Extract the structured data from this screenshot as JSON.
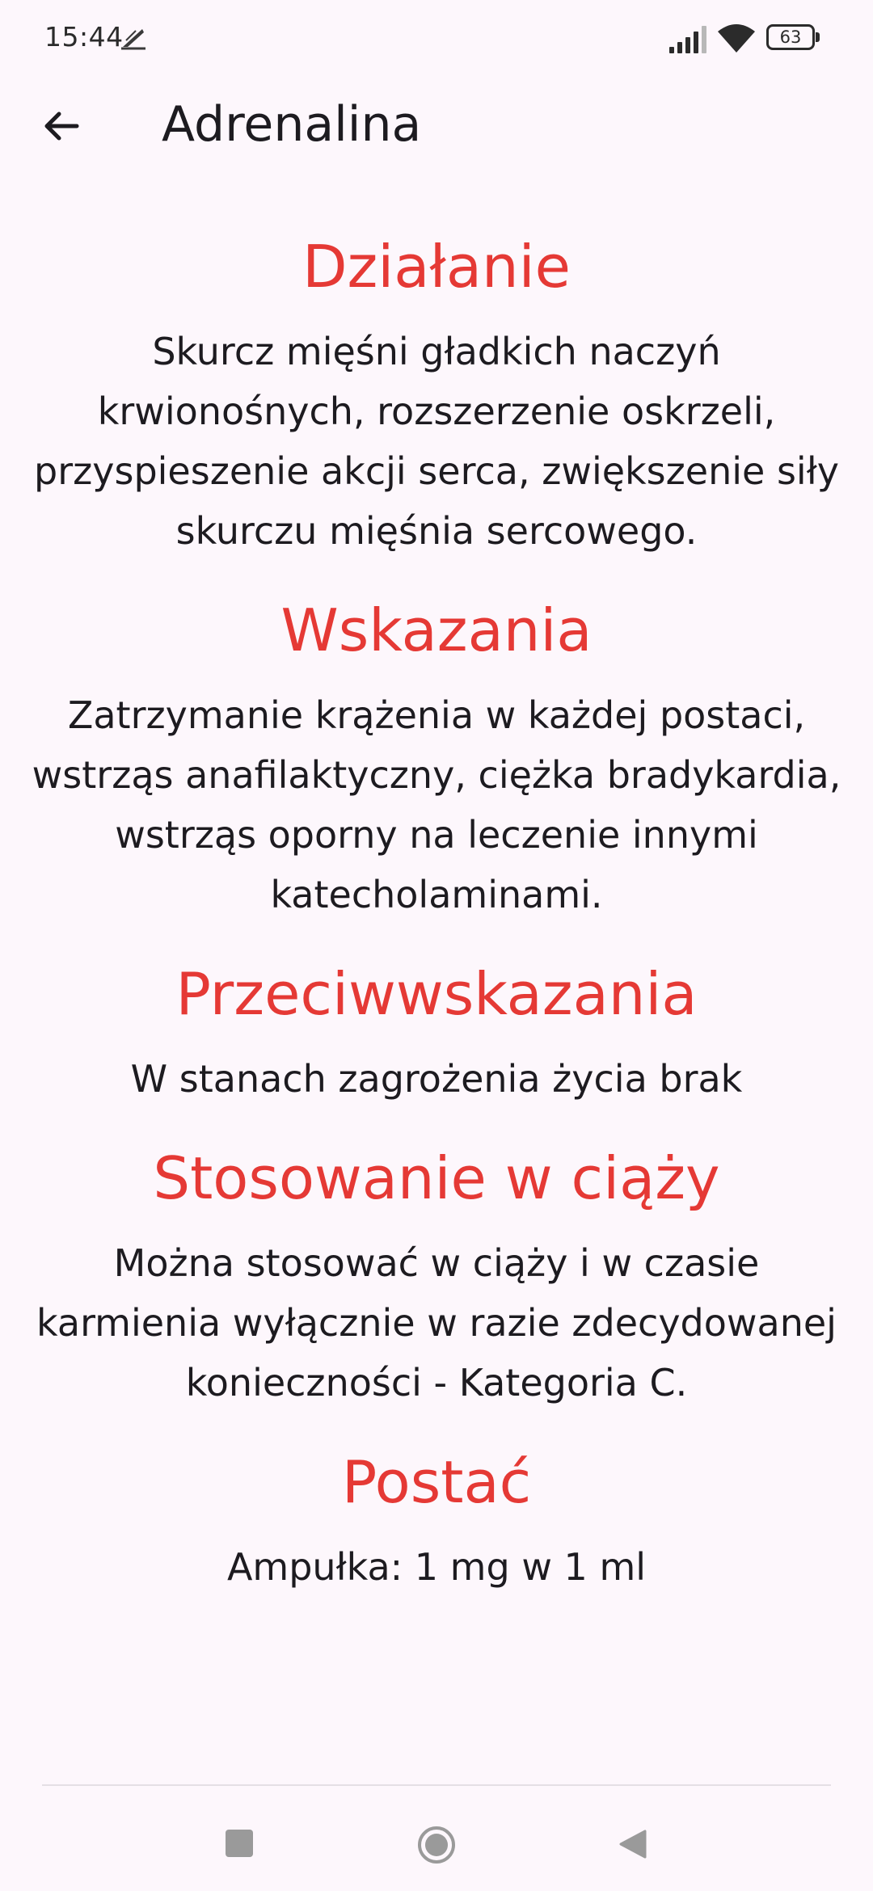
{
  "status_bar": {
    "time": "15:44",
    "battery": "63",
    "icons": [
      "notification-icon",
      "signal-icon",
      "wifi-icon",
      "battery-icon"
    ]
  },
  "app_bar": {
    "title": "Adrenalina",
    "back_icon": "arrow-back-icon"
  },
  "sections": [
    {
      "heading": "Działanie",
      "body": "Skurcz mięśni gładkich naczyń krwionośnych, rozszerzenie oskrzeli, przyspieszenie akcji serca, zwiększenie siły skurczu mięśnia sercowego."
    },
    {
      "heading": "Wskazania",
      "body": "Zatrzymanie krążenia w każdej postaci, wstrząs anafilaktyczny, ciężka bradykardia, wstrząs oporny na leczenie innymi katecholaminami."
    },
    {
      "heading": "Przeciwwskazania",
      "body": "W stanach zagrożenia życia brak"
    },
    {
      "heading": "Stosowanie w ciąży",
      "body": "Można stosować w ciąży i w czasie karmienia wyłącznie w razie zdecydowanej konieczności - Kategoria C."
    },
    {
      "heading": "Postać",
      "body": "Ampułka: 1 mg w 1 ml"
    }
  ],
  "nav_bar": {
    "buttons": [
      "recents-icon",
      "home-icon",
      "back-triangle-icon"
    ]
  },
  "colors": {
    "accent": "#e53935",
    "background": "#fdf7fc",
    "text": "#1d1b20"
  }
}
